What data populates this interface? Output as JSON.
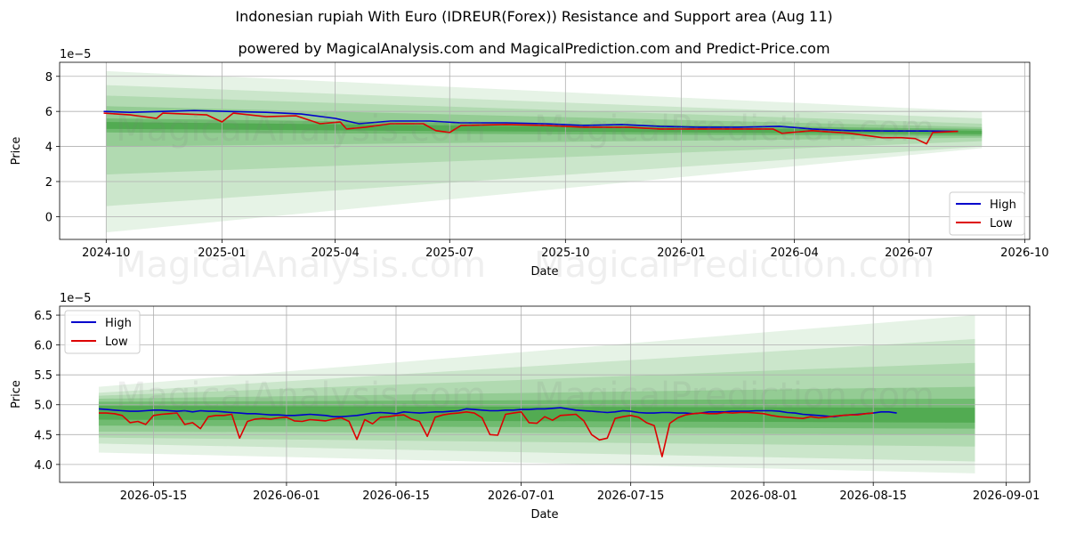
{
  "header": {
    "title": "Indonesian rupiah With Euro (IDREUR(Forex)) Resistance and Support area (Aug 11)",
    "subtitle": "powered by MagicalAnalysis.com and MagicalPrediction.com and Predict-Price.com"
  },
  "watermarks": [
    "MagicalAnalysis.com",
    "MagicalPrediction.com"
  ],
  "colors": {
    "high": "#0000cc",
    "low": "#dd0000",
    "band": "#2e9a2e",
    "grid": "#b0b0b0"
  },
  "chart_data": [
    {
      "type": "line",
      "xlabel": "Date",
      "ylabel": "Price",
      "y_offset_label": "1e−5",
      "x_ticks": [
        "2024-10",
        "2025-01",
        "2025-04",
        "2025-07",
        "2025-10",
        "2026-01",
        "2026-04",
        "2026-07",
        "2026-10"
      ],
      "y_ticks": [
        "0",
        "2",
        "4",
        "6",
        "8"
      ],
      "ylim": [
        -1.3,
        8.8
      ],
      "legend": {
        "position": "lower-right",
        "entries": [
          "High",
          "Low"
        ]
      },
      "grid": true,
      "bands_from": "2024-10-01",
      "bands_to": "2026-08-28",
      "bands": [
        {
          "start": [
            -0.9,
            8.3
          ],
          "end": [
            3.9,
            6.0
          ],
          "alpha": 0.12
        },
        {
          "start": [
            0.6,
            7.5
          ],
          "end": [
            4.0,
            5.6
          ],
          "alpha": 0.14
        },
        {
          "start": [
            2.4,
            6.9
          ],
          "end": [
            4.3,
            5.3
          ],
          "alpha": 0.16
        },
        {
          "start": [
            4.0,
            6.3
          ],
          "end": [
            4.5,
            5.1
          ],
          "alpha": 0.22
        },
        {
          "start": [
            4.8,
            5.6
          ],
          "end": [
            4.6,
            5.0
          ],
          "alpha": 0.35
        },
        {
          "start": [
            5.0,
            5.4
          ],
          "end": [
            4.7,
            4.9
          ],
          "alpha": 0.45
        }
      ],
      "series": [
        {
          "name": "High",
          "points": [
            [
              "2024-09-29",
              6.0
            ],
            [
              "2024-10-20",
              5.95
            ],
            [
              "2024-11-15",
              6.0
            ],
            [
              "2024-12-10",
              6.05
            ],
            [
              "2025-01-05",
              6.0
            ],
            [
              "2025-02-05",
              5.95
            ],
            [
              "2025-03-05",
              5.85
            ],
            [
              "2025-04-01",
              5.6
            ],
            [
              "2025-04-20",
              5.3
            ],
            [
              "2025-05-15",
              5.45
            ],
            [
              "2025-06-15",
              5.45
            ],
            [
              "2025-07-10",
              5.35
            ],
            [
              "2025-08-15",
              5.35
            ],
            [
              "2025-09-15",
              5.3
            ],
            [
              "2025-10-15",
              5.2
            ],
            [
              "2025-11-15",
              5.25
            ],
            [
              "2025-12-15",
              5.15
            ],
            [
              "2026-01-15",
              5.1
            ],
            [
              "2026-02-15",
              5.1
            ],
            [
              "2026-03-20",
              5.15
            ],
            [
              "2026-04-15",
              5.0
            ],
            [
              "2026-05-15",
              4.9
            ],
            [
              "2026-06-15",
              4.88
            ],
            [
              "2026-07-15",
              4.88
            ],
            [
              "2026-08-09",
              4.86
            ]
          ]
        },
        {
          "name": "Low",
          "points": [
            [
              "2024-09-29",
              5.9
            ],
            [
              "2024-10-20",
              5.8
            ],
            [
              "2024-11-10",
              5.6
            ],
            [
              "2024-11-15",
              5.9
            ],
            [
              "2024-12-20",
              5.8
            ],
            [
              "2025-01-01",
              5.4
            ],
            [
              "2025-01-10",
              5.9
            ],
            [
              "2025-02-05",
              5.7
            ],
            [
              "2025-03-01",
              5.75
            ],
            [
              "2025-03-20",
              5.3
            ],
            [
              "2025-04-05",
              5.4
            ],
            [
              "2025-04-10",
              5.0
            ],
            [
              "2025-04-25",
              5.1
            ],
            [
              "2025-05-15",
              5.3
            ],
            [
              "2025-06-10",
              5.3
            ],
            [
              "2025-06-20",
              4.9
            ],
            [
              "2025-07-01",
              4.8
            ],
            [
              "2025-07-10",
              5.2
            ],
            [
              "2025-08-15",
              5.25
            ],
            [
              "2025-09-15",
              5.2
            ],
            [
              "2025-10-15",
              5.1
            ],
            [
              "2025-11-20",
              5.1
            ],
            [
              "2025-12-15",
              5.0
            ],
            [
              "2026-01-15",
              5.0
            ],
            [
              "2026-02-15",
              5.0
            ],
            [
              "2026-03-15",
              5.0
            ],
            [
              "2026-03-22",
              4.75
            ],
            [
              "2026-04-15",
              4.9
            ],
            [
              "2026-05-15",
              4.75
            ],
            [
              "2026-06-10",
              4.5
            ],
            [
              "2026-06-25",
              4.5
            ],
            [
              "2026-07-06",
              4.45
            ],
            [
              "2026-07-15",
              4.15
            ],
            [
              "2026-07-20",
              4.8
            ],
            [
              "2026-08-09",
              4.86
            ]
          ]
        }
      ]
    },
    {
      "type": "line",
      "xlabel": "Date",
      "ylabel": "Price",
      "y_offset_label": "1e−5",
      "x_ticks": [
        "2026-05-15",
        "2026-06-01",
        "2026-06-15",
        "2026-07-01",
        "2026-07-15",
        "2026-08-01",
        "2026-08-15",
        "2026-09-01"
      ],
      "y_ticks": [
        "4.0",
        "4.5",
        "5.0",
        "5.5",
        "6.0",
        "6.5"
      ],
      "ylim": [
        3.7,
        6.65
      ],
      "legend": {
        "position": "upper-left",
        "entries": [
          "High",
          "Low"
        ]
      },
      "grid": true,
      "bands_from": "2026-05-08",
      "bands_to": "2026-08-28",
      "bands": [
        {
          "start": [
            4.2,
            5.3
          ],
          "end": [
            3.85,
            6.5
          ],
          "alpha": 0.12
        },
        {
          "start": [
            4.35,
            5.2
          ],
          "end": [
            4.05,
            6.1
          ],
          "alpha": 0.14
        },
        {
          "start": [
            4.45,
            5.15
          ],
          "end": [
            4.3,
            5.7
          ],
          "alpha": 0.16
        },
        {
          "start": [
            4.55,
            5.1
          ],
          "end": [
            4.5,
            5.3
          ],
          "alpha": 0.22
        },
        {
          "start": [
            4.65,
            5.05
          ],
          "end": [
            4.6,
            5.1
          ],
          "alpha": 0.35
        },
        {
          "start": [
            4.75,
            4.98
          ],
          "end": [
            4.7,
            4.95
          ],
          "alpha": 0.45
        }
      ],
      "series": [
        {
          "name": "High",
          "dates_from": "2026-05-08",
          "values": [
            4.93,
            4.92,
            4.91,
            4.9,
            4.89,
            4.89,
            4.9,
            4.91,
            4.91,
            4.9,
            4.89,
            4.9,
            4.88,
            4.9,
            4.89,
            4.89,
            4.88,
            4.87,
            4.86,
            4.85,
            4.85,
            4.84,
            4.83,
            4.83,
            4.82,
            4.82,
            4.83,
            4.84,
            4.83,
            4.82,
            4.8,
            4.8,
            4.81,
            4.82,
            4.84,
            4.86,
            4.87,
            4.86,
            4.85,
            4.88,
            4.87,
            4.86,
            4.87,
            4.88,
            4.88,
            4.89,
            4.9,
            4.93,
            4.92,
            4.91,
            4.9,
            4.9,
            4.91,
            4.91,
            4.92,
            4.92,
            4.93,
            4.93,
            4.94,
            4.95,
            4.93,
            4.91,
            4.9,
            4.89,
            4.88,
            4.87,
            4.88,
            4.9,
            4.89,
            4.87,
            4.86,
            4.86,
            4.87,
            4.87,
            4.86,
            4.86,
            4.85,
            4.86,
            4.88,
            4.88,
            4.88,
            4.89,
            4.89,
            4.89,
            4.9,
            4.9,
            4.9,
            4.89,
            4.87,
            4.86,
            4.84,
            4.83,
            4.82,
            4.81,
            4.8,
            4.82,
            4.83,
            4.84,
            4.85,
            4.86,
            4.88,
            4.88,
            4.86
          ]
        },
        {
          "name": "Low",
          "dates_from": "2026-05-08",
          "values": [
            4.86,
            4.86,
            4.85,
            4.82,
            4.7,
            4.72,
            4.67,
            4.82,
            4.84,
            4.85,
            4.86,
            4.67,
            4.7,
            4.6,
            4.8,
            4.82,
            4.82,
            4.84,
            4.44,
            4.72,
            4.76,
            4.77,
            4.76,
            4.78,
            4.79,
            4.73,
            4.72,
            4.75,
            4.74,
            4.73,
            4.76,
            4.78,
            4.72,
            4.42,
            4.75,
            4.68,
            4.79,
            4.8,
            4.82,
            4.83,
            4.76,
            4.72,
            4.47,
            4.79,
            4.83,
            4.85,
            4.86,
            4.88,
            4.86,
            4.78,
            4.5,
            4.49,
            4.84,
            4.86,
            4.88,
            4.7,
            4.69,
            4.8,
            4.74,
            4.82,
            4.83,
            4.84,
            4.73,
            4.5,
            4.41,
            4.44,
            4.77,
            4.8,
            4.82,
            4.79,
            4.7,
            4.65,
            4.13,
            4.69,
            4.78,
            4.83,
            4.85,
            4.86,
            4.85,
            4.85,
            4.87,
            4.86,
            4.87,
            4.87,
            4.86,
            4.85,
            4.82,
            4.8,
            4.79,
            4.78,
            4.77,
            4.8,
            4.78,
            4.79,
            4.81,
            4.82,
            4.83,
            4.83,
            4.85,
            4.86
          ]
        }
      ]
    }
  ]
}
